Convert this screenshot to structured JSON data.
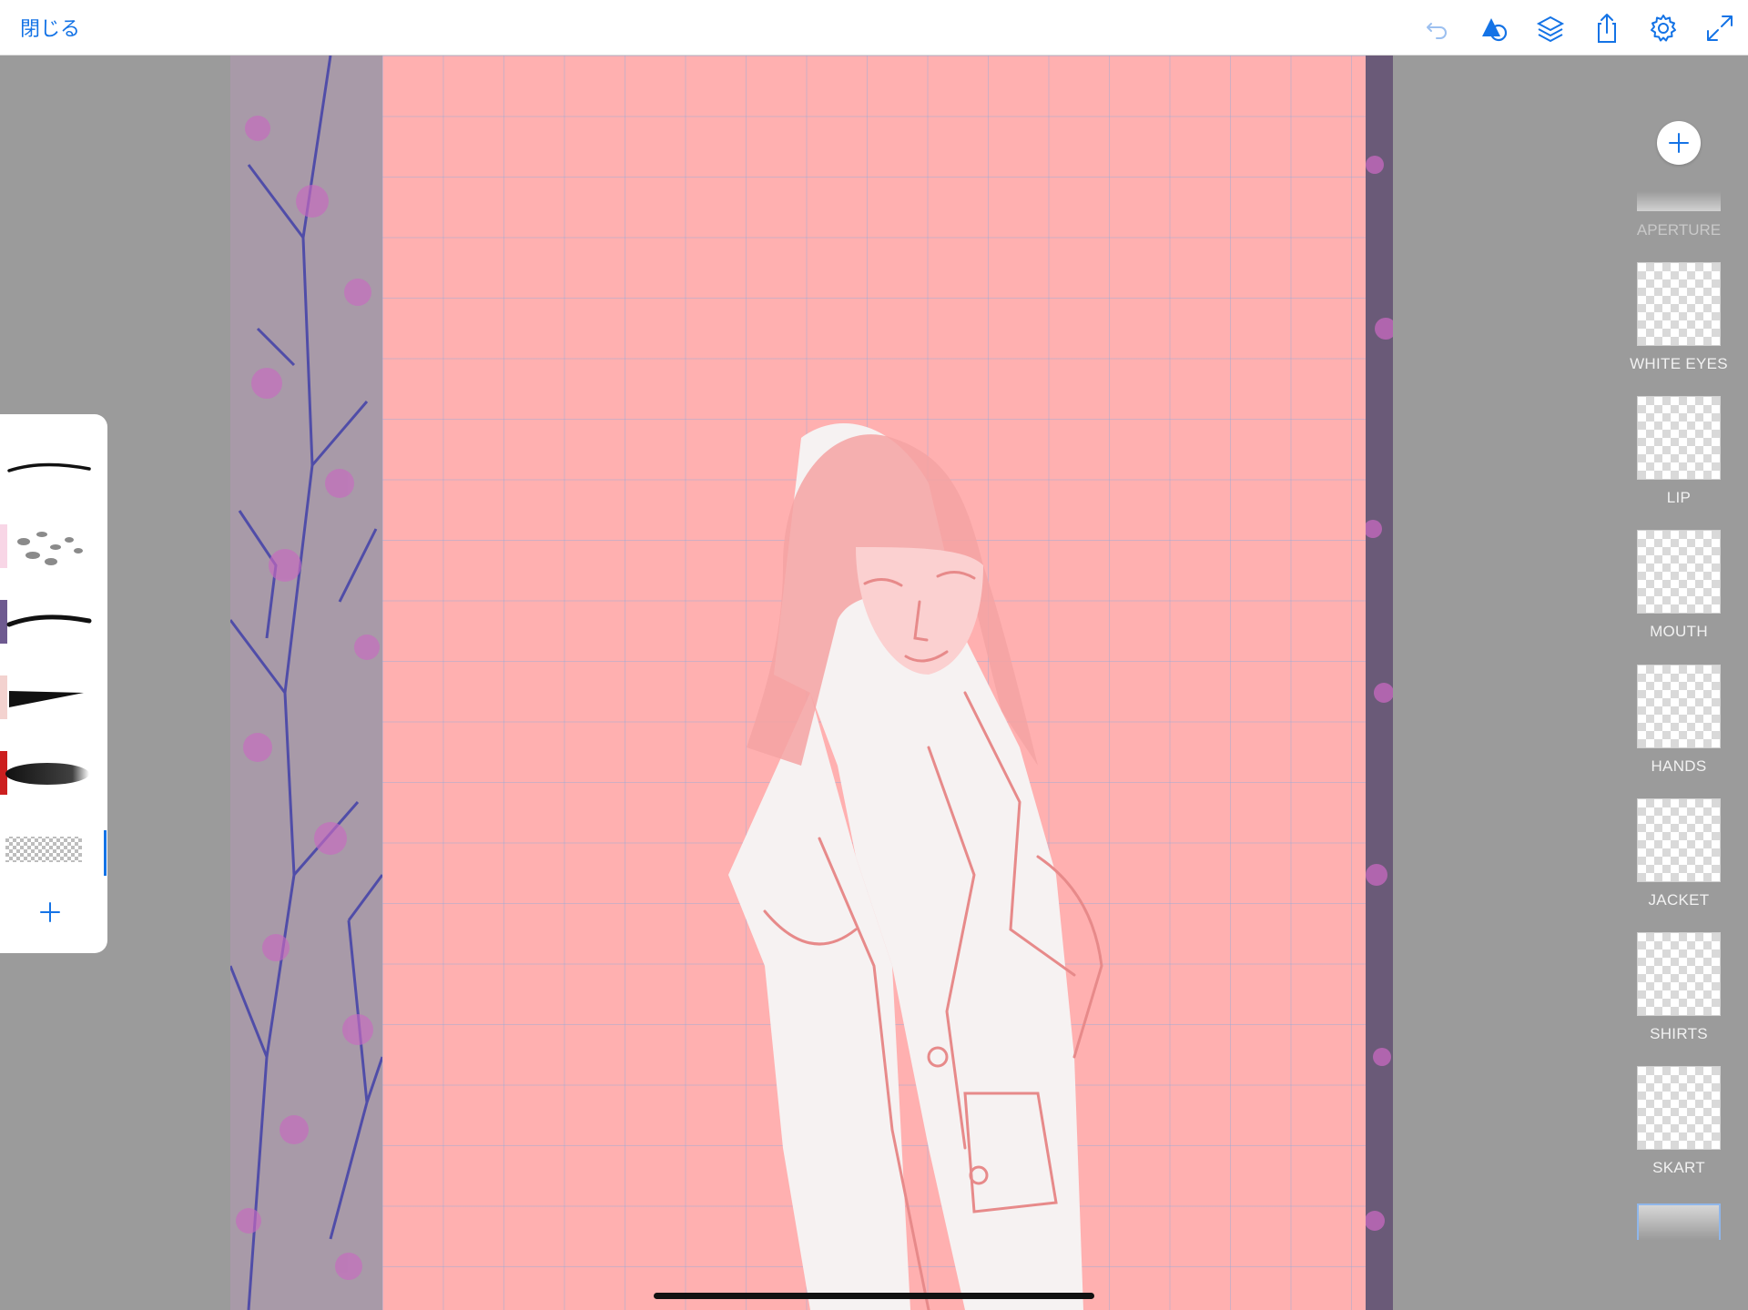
{
  "toolbar": {
    "close_label": "閉じる",
    "icons": [
      "undo-icon",
      "shapes-icon",
      "layers-icon",
      "share-icon",
      "settings-icon",
      "fullscreen-icon"
    ]
  },
  "colors": {
    "accent": "#1473e6",
    "canvas": "#ffb0b0",
    "workspace": "#9b9b9b",
    "swatch_1": "#f8d6e6",
    "swatch_2": "#6e5a90",
    "swatch_3": "#f3d2cf",
    "swatch_4": "#cc1f1f"
  },
  "brushes": {
    "items": [
      "pen-stroke",
      "scatter-leaves",
      "taper-stroke",
      "thick-taper",
      "soft-airbrush",
      "eraser-checker"
    ],
    "add_icon": "plus-icon"
  },
  "layers": {
    "add_icon": "plus-icon",
    "partial_top_label": "APERTURE",
    "items": [
      {
        "label": "WHITE EYES"
      },
      {
        "label": "LIP"
      },
      {
        "label": "MOUTH"
      },
      {
        "label": "HANDS"
      },
      {
        "label": "JACKET"
      },
      {
        "label": "SHIRTS"
      },
      {
        "label": "SKART"
      }
    ]
  }
}
